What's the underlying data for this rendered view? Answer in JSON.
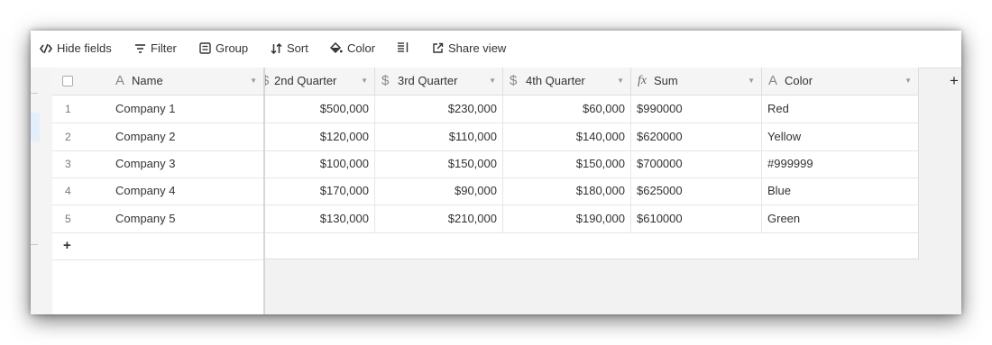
{
  "toolbar": {
    "hide_fields": "Hide fields",
    "filter": "Filter",
    "group": "Group",
    "sort": "Sort",
    "color": "Color",
    "share_view": "Share view"
  },
  "columns": {
    "name": "Name",
    "q2": "2nd Quarter",
    "q3": "3rd Quarter",
    "q4": "4th Quarter",
    "sum": "Sum",
    "color": "Color",
    "sum_icon": "fx",
    "add": "+"
  },
  "rows": [
    {
      "num": "1",
      "name": "Company 1",
      "q2": "$500,000",
      "q3": "$230,000",
      "q4": "$60,000",
      "sum": "$990000",
      "color": "Red"
    },
    {
      "num": "2",
      "name": "Company 2",
      "q2": "$120,000",
      "q3": "$110,000",
      "q4": "$140,000",
      "sum": "$620000",
      "color": "Yellow"
    },
    {
      "num": "3",
      "name": "Company 3",
      "q2": "$100,000",
      "q3": "$150,000",
      "q4": "$150,000",
      "sum": "$700000",
      "color": "#999999"
    },
    {
      "num": "4",
      "name": "Company 4",
      "q2": "$170,000",
      "q3": "$90,000",
      "q4": "$180,000",
      "sum": "$625000",
      "color": "Blue"
    },
    {
      "num": "5",
      "name": "Company 5",
      "q2": "$130,000",
      "q3": "$210,000",
      "q4": "$190,000",
      "sum": "$610000",
      "color": "Green"
    }
  ],
  "add_row": "+"
}
